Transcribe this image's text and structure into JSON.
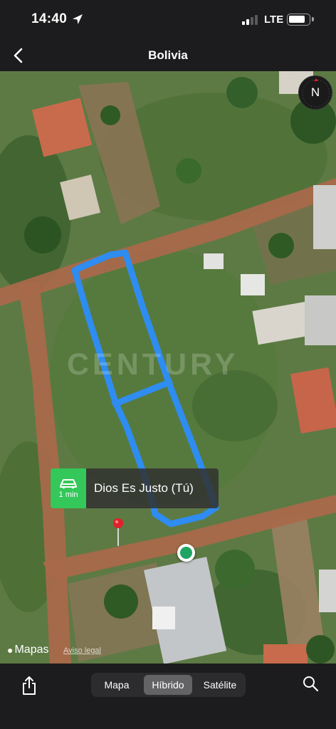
{
  "status_bar": {
    "time": "14:40",
    "network": "LTE",
    "icons": [
      "location-arrow-icon",
      "signal-icon",
      "battery-icon"
    ]
  },
  "nav": {
    "title": "Bolivia",
    "back_icon": "chevron-left-icon"
  },
  "map": {
    "compass_label": "N",
    "watermark": "CENTURY",
    "eta": {
      "time": "1 min",
      "icon": "car-icon"
    },
    "place_label": "Dios Es Justo (Tú)",
    "attribution": {
      "brand": "Mapas",
      "legal": "Aviso legal"
    },
    "colors": {
      "highlight": "#2f8cf0",
      "user_location": "#1fa463",
      "pin": "#e0212b",
      "eta_badge": "#34c759"
    }
  },
  "toolbar": {
    "share_icon": "share-icon",
    "segments": [
      {
        "label": "Mapa",
        "selected": false
      },
      {
        "label": "Híbrido",
        "selected": true
      },
      {
        "label": "Satélite",
        "selected": false
      }
    ],
    "search_icon": "search-icon"
  }
}
